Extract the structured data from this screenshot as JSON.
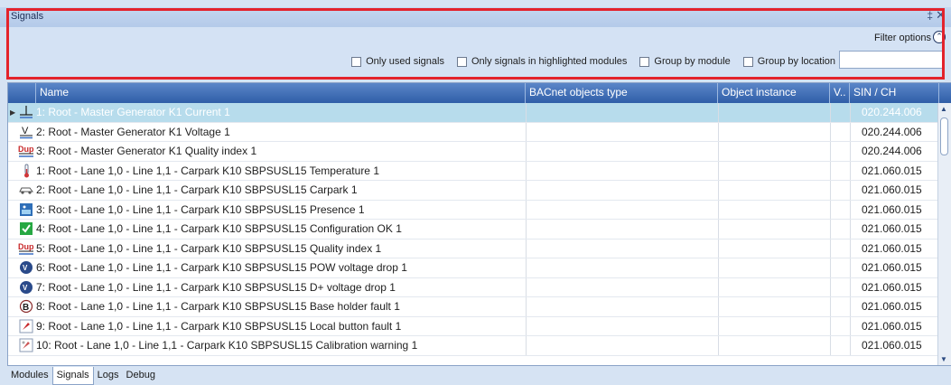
{
  "panel": {
    "title": "Signals",
    "pin": "‡",
    "close": "✕"
  },
  "filter": {
    "options_label": "Filter options",
    "checkboxes": [
      {
        "label": "Only used signals",
        "checked": false
      },
      {
        "label": "Only signals in highlighted modules",
        "checked": false
      },
      {
        "label": "Group by module",
        "checked": false
      },
      {
        "label": "Group by location",
        "checked": false
      }
    ],
    "search_value": ""
  },
  "grid": {
    "columns": [
      "Name",
      "BACnet objects type",
      "Object instance",
      "V..",
      "SIN / CH"
    ],
    "rows": [
      {
        "icon": "current-icon",
        "name": "1: Root - Master Generator K1 Current 1",
        "bacnet": "",
        "instance": "",
        "v": "",
        "sin": "020.244.006",
        "selected": true
      },
      {
        "icon": "voltage-icon",
        "name": "2: Root - Master Generator K1 Voltage 1",
        "bacnet": "",
        "instance": "",
        "v": "",
        "sin": "020.244.006"
      },
      {
        "icon": "dup-icon",
        "name": "3: Root - Master Generator K1 Quality index 1",
        "bacnet": "",
        "instance": "",
        "v": "",
        "sin": "020.244.006"
      },
      {
        "icon": "thermometer-icon",
        "name": "1: Root - Lane 1,0 - Line 1,1 - Carpark K10 SBPSUSL15 Temperature 1",
        "bacnet": "",
        "instance": "",
        "v": "",
        "sin": "021.060.015"
      },
      {
        "icon": "car-icon",
        "name": "2: Root - Lane 1,0 - Line 1,1 - Carpark K10 SBPSUSL15 Carpark 1",
        "bacnet": "",
        "instance": "",
        "v": "",
        "sin": "021.060.015"
      },
      {
        "icon": "presence-icon",
        "name": "3: Root - Lane 1,0 - Line 1,1 - Carpark K10 SBPSUSL15 Presence 1",
        "bacnet": "",
        "instance": "",
        "v": "",
        "sin": "021.060.015"
      },
      {
        "icon": "config-ok-icon",
        "name": "4: Root - Lane 1,0 - Line 1,1 - Carpark K10 SBPSUSL15 Configuration OK 1",
        "bacnet": "",
        "instance": "",
        "v": "",
        "sin": "021.060.015"
      },
      {
        "icon": "dup-icon",
        "name": "5: Root - Lane 1,0 - Line 1,1 - Carpark K10 SBPSUSL15 Quality index 1",
        "bacnet": "",
        "instance": "",
        "v": "",
        "sin": "021.060.015"
      },
      {
        "icon": "voltage-drop-icon",
        "name": "6: Root - Lane 1,0 - Line 1,1 - Carpark K10 SBPSUSL15 POW voltage drop 1",
        "bacnet": "",
        "instance": "",
        "v": "",
        "sin": "021.060.015"
      },
      {
        "icon": "voltage-drop-icon",
        "name": "7: Root - Lane 1,0 - Line 1,1 - Carpark K10 SBPSUSL15 D+ voltage drop 1",
        "bacnet": "",
        "instance": "",
        "v": "",
        "sin": "021.060.015"
      },
      {
        "icon": "base-holder-icon",
        "name": "8: Root - Lane 1,0 - Line 1,1 - Carpark K10 SBPSUSL15 Base holder fault 1",
        "bacnet": "",
        "instance": "",
        "v": "",
        "sin": "021.060.015"
      },
      {
        "icon": "button-fault-icon",
        "name": "9: Root - Lane 1,0 - Line 1,1 - Carpark K10 SBPSUSL15 Local button fault 1",
        "bacnet": "",
        "instance": "",
        "v": "",
        "sin": "021.060.015"
      },
      {
        "icon": "calibration-icon",
        "name": "10: Root - Lane 1,0 - Line 1,1 - Carpark K10 SBPSUSL15 Calibration warning 1",
        "bacnet": "",
        "instance": "",
        "v": "",
        "sin": "021.060.015"
      }
    ]
  },
  "tabs": [
    {
      "label": "Modules",
      "active": false
    },
    {
      "label": "Signals",
      "active": true
    },
    {
      "label": "Logs",
      "active": false
    },
    {
      "label": "Debug",
      "active": false
    }
  ],
  "colors": {
    "accent": "#2f5ea8",
    "highlight_border": "#e3232c",
    "selected_row": "#b7dcec"
  }
}
